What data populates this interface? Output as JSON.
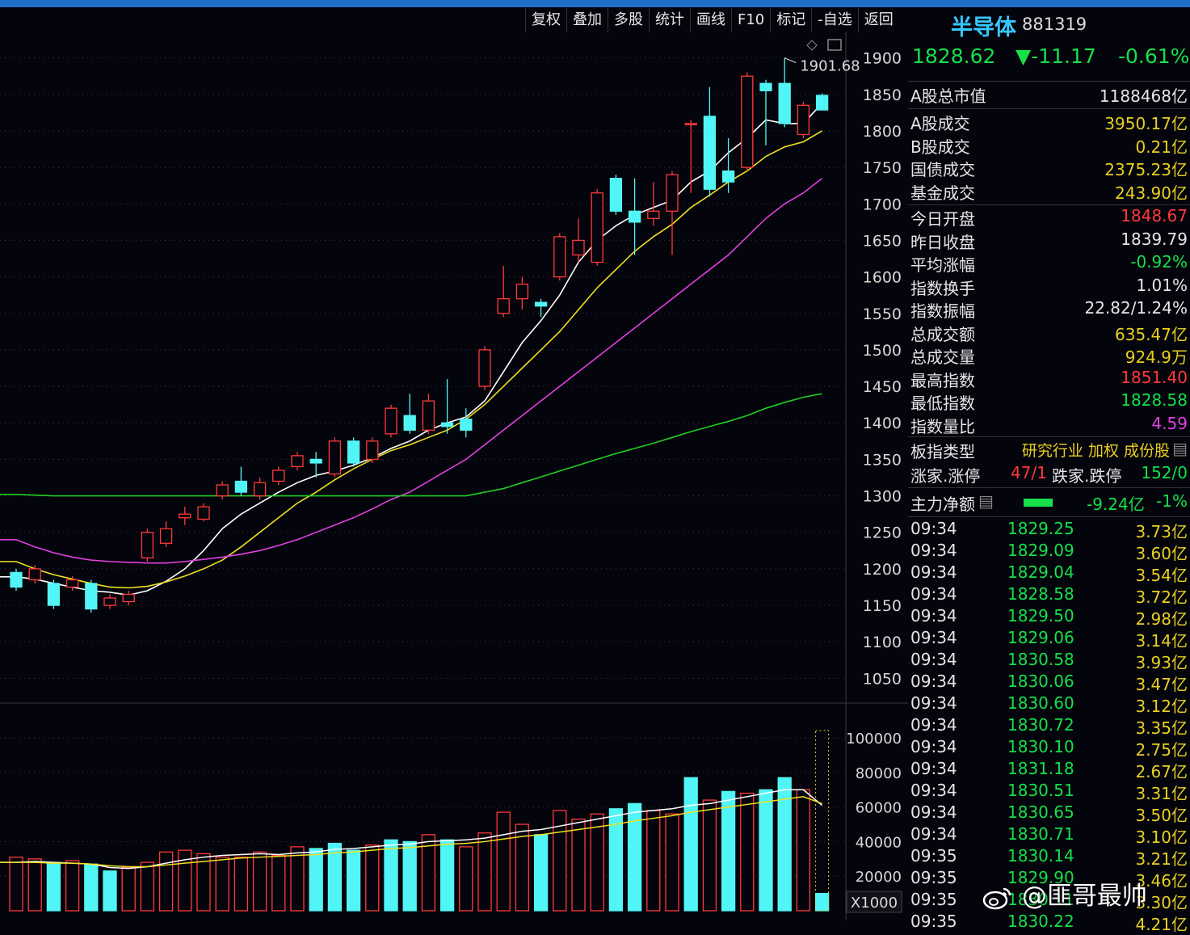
{
  "toolbar": [
    "复权",
    "叠加",
    "多股",
    "统计",
    "画线",
    "F10",
    "标记",
    "-自选",
    "返回"
  ],
  "chart_data": [
    {
      "type": "candlestick",
      "y_ticks": [
        1900,
        1850,
        1800,
        1750,
        1700,
        1650,
        1600,
        1550,
        1500,
        1450,
        1400,
        1350,
        1300,
        1250,
        1200,
        1150,
        1100,
        1050
      ],
      "ylim": [
        1015,
        1935
      ],
      "annotation": "1901.68",
      "candles": [
        [
          1195,
          1175,
          1200,
          1170
        ],
        [
          1185,
          1200,
          1205,
          1180
        ],
        [
          1180,
          1150,
          1185,
          1145
        ],
        [
          1175,
          1185,
          1190,
          1170
        ],
        [
          1180,
          1145,
          1185,
          1140
        ],
        [
          1150,
          1160,
          1165,
          1145
        ],
        [
          1155,
          1165,
          1170,
          1150
        ],
        [
          1215,
          1250,
          1255,
          1210
        ],
        [
          1235,
          1255,
          1265,
          1230
        ],
        [
          1270,
          1275,
          1285,
          1260
        ],
        [
          1268,
          1285,
          1290,
          1265
        ],
        [
          1300,
          1315,
          1320,
          1295
        ],
        [
          1320,
          1305,
          1340,
          1300
        ],
        [
          1300,
          1318,
          1325,
          1295
        ],
        [
          1320,
          1335,
          1340,
          1315
        ],
        [
          1340,
          1355,
          1360,
          1335
        ],
        [
          1350,
          1345,
          1360,
          1325
        ],
        [
          1330,
          1375,
          1380,
          1325
        ],
        [
          1375,
          1345,
          1380,
          1340
        ],
        [
          1350,
          1375,
          1380,
          1345
        ],
        [
          1385,
          1420,
          1425,
          1380
        ],
        [
          1410,
          1390,
          1440,
          1385
        ],
        [
          1390,
          1430,
          1440,
          1385
        ],
        [
          1400,
          1395,
          1460,
          1385
        ],
        [
          1405,
          1390,
          1420,
          1380
        ],
        [
          1450,
          1500,
          1505,
          1445
        ],
        [
          1550,
          1570,
          1615,
          1545
        ],
        [
          1570,
          1590,
          1600,
          1555
        ],
        [
          1565,
          1560,
          1570,
          1545
        ],
        [
          1600,
          1655,
          1660,
          1595
        ],
        [
          1630,
          1650,
          1680,
          1620
        ],
        [
          1620,
          1715,
          1720,
          1615
        ],
        [
          1735,
          1690,
          1740,
          1685
        ],
        [
          1690,
          1675,
          1735,
          1630
        ],
        [
          1680,
          1690,
          1730,
          1670
        ],
        [
          1690,
          1740,
          1745,
          1630
        ],
        [
          1810,
          1810,
          1815,
          1715
        ],
        [
          1820,
          1720,
          1860,
          1710
        ],
        [
          1745,
          1730,
          1790,
          1715
        ],
        [
          1750,
          1875,
          1880,
          1745
        ],
        [
          1865,
          1855,
          1870,
          1780
        ],
        [
          1865,
          1810,
          1900,
          1805
        ],
        [
          1795,
          1835,
          1840,
          1790
        ],
        [
          1848.67,
          1828.62,
          1851.4,
          1828.58
        ]
      ],
      "ma_series": [
        {
          "color": "#ffffff",
          "values": [
            1189,
            1186,
            1180,
            1175,
            1170,
            1168,
            1164,
            1170,
            1183,
            1200,
            1225,
            1255,
            1275,
            1290,
            1305,
            1318,
            1328,
            1334,
            1342,
            1352,
            1365,
            1375,
            1390,
            1400,
            1408,
            1430,
            1470,
            1510,
            1540,
            1575,
            1620,
            1650,
            1670,
            1685,
            1695,
            1705,
            1730,
            1745,
            1770,
            1790,
            1815,
            1810,
            1810,
            1838
          ]
        },
        {
          "color": "#f0e020",
          "values": [
            1210,
            1200,
            1192,
            1186,
            1180,
            1175,
            1174,
            1176,
            1182,
            1190,
            1200,
            1212,
            1230,
            1250,
            1270,
            1290,
            1305,
            1322,
            1337,
            1350,
            1362,
            1370,
            1380,
            1390,
            1405,
            1425,
            1450,
            1475,
            1500,
            1525,
            1555,
            1585,
            1610,
            1635,
            1655,
            1672,
            1695,
            1712,
            1730,
            1745,
            1765,
            1778,
            1785,
            1800
          ]
        },
        {
          "color": "#e040e0",
          "values": [
            1240,
            1230,
            1222,
            1216,
            1212,
            1210,
            1209,
            1208,
            1208,
            1210,
            1213,
            1216,
            1220,
            1225,
            1232,
            1240,
            1250,
            1260,
            1270,
            1282,
            1295,
            1305,
            1320,
            1335,
            1350,
            1370,
            1390,
            1410,
            1430,
            1450,
            1470,
            1490,
            1510,
            1530,
            1550,
            1570,
            1590,
            1610,
            1630,
            1655,
            1680,
            1700,
            1715,
            1735
          ]
        },
        {
          "color": "#20d020",
          "values": [
            1302,
            1301,
            1300,
            1300,
            1300,
            1300,
            1300,
            1300,
            1300,
            1300,
            1300,
            1300,
            1300,
            1300,
            1300,
            1300,
            1300,
            1300,
            1300,
            1300,
            1300,
            1300,
            1300,
            1300,
            1300,
            1305,
            1310,
            1318,
            1326,
            1334,
            1342,
            1350,
            1358,
            1365,
            1372,
            1380,
            1388,
            1395,
            1402,
            1410,
            1420,
            1428,
            1435,
            1440
          ]
        }
      ]
    },
    {
      "type": "bar",
      "y_ticks": [
        100000,
        80000,
        60000,
        40000,
        20000
      ],
      "unit_label": "X1000",
      "ylim": [
        0,
        115000
      ],
      "values": [
        31000,
        30000,
        28000,
        29000,
        27000,
        23000,
        25000,
        28000,
        34000,
        35000,
        33000,
        31000,
        31000,
        34000,
        32000,
        37000,
        36000,
        39000,
        35000,
        38000,
        41000,
        40000,
        44000,
        41000,
        37000,
        45000,
        57000,
        50000,
        44000,
        58000,
        53000,
        56000,
        59000,
        62000,
        58000,
        56000,
        77000,
        64000,
        69000,
        68000,
        70000,
        77000,
        70000,
        10000
      ],
      "rising": [
        true,
        true,
        false,
        true,
        false,
        false,
        true,
        true,
        true,
        true,
        true,
        true,
        true,
        true,
        true,
        true,
        false,
        false,
        false,
        true,
        false,
        false,
        true,
        false,
        true,
        true,
        true,
        true,
        false,
        true,
        true,
        true,
        false,
        false,
        true,
        true,
        false,
        true,
        false,
        true,
        false,
        false,
        true,
        false
      ],
      "ma_series": [
        {
          "color": "#ffffff",
          "values": [
            28000,
            28500,
            28000,
            27500,
            27000,
            25000,
            24500,
            25500,
            27500,
            29500,
            31000,
            32000,
            32500,
            33000,
            32500,
            33500,
            34000,
            35500,
            36000,
            37000,
            38000,
            38500,
            40000,
            40500,
            41000,
            42000,
            44000,
            46000,
            47000,
            49000,
            51000,
            53000,
            55000,
            57000,
            58000,
            59000,
            61000,
            62000,
            64000,
            66000,
            68000,
            70000,
            70000,
            61000
          ]
        },
        {
          "color": "#f0e020",
          "values": [
            28000,
            28000,
            27500,
            27500,
            27000,
            26000,
            25500,
            25500,
            26500,
            27500,
            28500,
            29500,
            30500,
            31000,
            31500,
            32000,
            32500,
            33500,
            34000,
            35000,
            36000,
            36500,
            37500,
            38500,
            39000,
            40000,
            41500,
            43000,
            44000,
            45500,
            47000,
            48500,
            50000,
            52000,
            53500,
            55000,
            57000,
            58500,
            60000,
            61500,
            63000,
            64500,
            66000,
            62000
          ]
        }
      ]
    }
  ],
  "side": {
    "title": "半导体",
    "code": "881319",
    "price": "1828.62",
    "change": "▼-11.17",
    "pct": "-0.61%",
    "market_cap_label": "A股总市值",
    "market_cap": "1188468亿",
    "turnover": [
      {
        "k": "A股成交",
        "v": "3950.17亿"
      },
      {
        "k": "B股成交",
        "v": "0.21亿"
      },
      {
        "k": "国债成交",
        "v": "2375.23亿"
      },
      {
        "k": "基金成交",
        "v": "243.90亿"
      }
    ],
    "stats": [
      {
        "k": "今日开盘",
        "v": "1848.67",
        "c": "red"
      },
      {
        "k": "昨日收盘",
        "v": "1839.79",
        "c": "white"
      },
      {
        "k": "平均涨幅",
        "v": "-0.92%",
        "c": "green"
      },
      {
        "k": "指数换手",
        "v": "1.01%",
        "c": "white"
      },
      {
        "k": "指数振幅",
        "v": "22.82/1.24%",
        "c": "white"
      },
      {
        "k": "总成交额",
        "v": "635.47亿",
        "c": "yellow"
      },
      {
        "k": "总成交量",
        "v": "924.9万",
        "c": "yellow"
      },
      {
        "k": "最高指数",
        "v": "1851.40",
        "c": "red"
      },
      {
        "k": "最低指数",
        "v": "1828.58",
        "c": "green"
      },
      {
        "k": "指数量比",
        "v": "4.59",
        "c": "magenta"
      }
    ],
    "type_label": "板指类型",
    "type_value": "研究行业 加权 成份股",
    "up_label": "涨家.涨停",
    "up_value": "47/1",
    "down_label": "跌家.跌停",
    "down_value": "152/0",
    "main_flow_label": "主力净额",
    "main_flow_value": "-9.24亿",
    "main_flow_pct": "-1%",
    "ticks": [
      {
        "t": "09:34",
        "p": "1829.25",
        "a": "3.73亿"
      },
      {
        "t": "09:34",
        "p": "1829.09",
        "a": "3.60亿"
      },
      {
        "t": "09:34",
        "p": "1829.04",
        "a": "3.54亿"
      },
      {
        "t": "09:34",
        "p": "1828.58",
        "a": "3.72亿"
      },
      {
        "t": "09:34",
        "p": "1829.50",
        "a": "2.98亿"
      },
      {
        "t": "09:34",
        "p": "1829.06",
        "a": "3.14亿"
      },
      {
        "t": "09:34",
        "p": "1830.58",
        "a": "3.93亿"
      },
      {
        "t": "09:34",
        "p": "1830.06",
        "a": "3.47亿"
      },
      {
        "t": "09:34",
        "p": "1830.60",
        "a": "3.12亿"
      },
      {
        "t": "09:34",
        "p": "1830.72",
        "a": "3.35亿"
      },
      {
        "t": "09:34",
        "p": "1830.10",
        "a": "2.75亿"
      },
      {
        "t": "09:34",
        "p": "1831.18",
        "a": "2.67亿"
      },
      {
        "t": "09:34",
        "p": "1830.51",
        "a": "3.31亿"
      },
      {
        "t": "09:34",
        "p": "1830.65",
        "a": "3.50亿"
      },
      {
        "t": "09:34",
        "p": "1830.71",
        "a": "3.10亿"
      },
      {
        "t": "09:35",
        "p": "1830.14",
        "a": "3.21亿"
      },
      {
        "t": "09:35",
        "p": "1829.90",
        "a": "3.46亿"
      },
      {
        "t": "09:35",
        "p": "1830.11",
        "a": "3.30亿"
      },
      {
        "t": "09:35",
        "p": "1830.22",
        "a": "4.21亿"
      }
    ]
  },
  "watermark": "@匪哥最帅"
}
